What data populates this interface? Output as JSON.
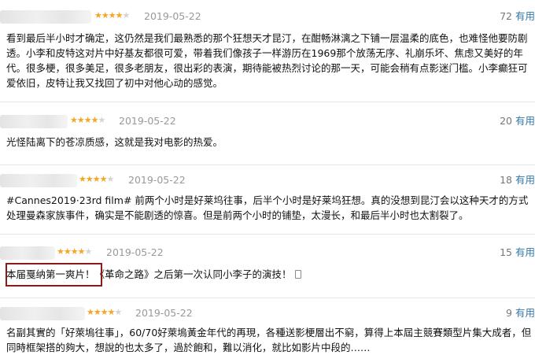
{
  "reviews": [
    {
      "rating": 4,
      "date": "2019-05-22",
      "votes": "72",
      "votes_label": "有用",
      "text": "看到最后半小时才确定，这仍然是我们最熟悉的那个狂想天才昆汀，在酣畅淋漓之下铺一层温柔的底色，也难怪他要防剧透。小李和皮特这对片中好基友都很可爱，带着我们像孩子一样游历在1969那个放荡无序、礼崩乐坏、焦虑又美好的年代。很多梗，很多美足，很多老朋友，很出彩的表演，期待能被热烈讨论的那一天，可能会稍有点影迷门槛。小李癫狂可爱依旧，皮特让我又找回了初中对他心动的感觉。"
    },
    {
      "rating": 4,
      "date": "2019-05-22",
      "votes": "20",
      "votes_label": "有用",
      "text": "光怪陆离下的苍凉质感，这就是我对电影的热爱。"
    },
    {
      "rating": 4,
      "date": "2019-05-22",
      "votes": "18",
      "votes_label": "有用",
      "text": "#Cannes2019·23rd film# 前两个小时是好莱坞往事，后半个小时是好莱坞狂想。真的没想到昆汀会以这种天才的方式处理曼森家族事件，确实是不能剧透的惊喜。但是前两个小时的铺垫，太漫长，和最后半小时也太割裂了。"
    },
    {
      "rating": 4,
      "date": "2019-05-22",
      "votes": "15",
      "votes_label": "有用",
      "text": "本届戛纳第一爽片！《革命之路》之后第一次认同小李子的演技！"
    },
    {
      "rating": 4,
      "date": "2019-05-22",
      "votes": "9",
      "votes_label": "有用",
      "text": "名副其實的「好萊塢往事」，60/70好萊塢黃金年代的再現，各種送影梗層出不窮，算得上本屆主競賽類型片集大成者，但同時框架搭的夠大，想說的也太多了，過於飽和，難以消化，就比如影片中段的……"
    }
  ]
}
